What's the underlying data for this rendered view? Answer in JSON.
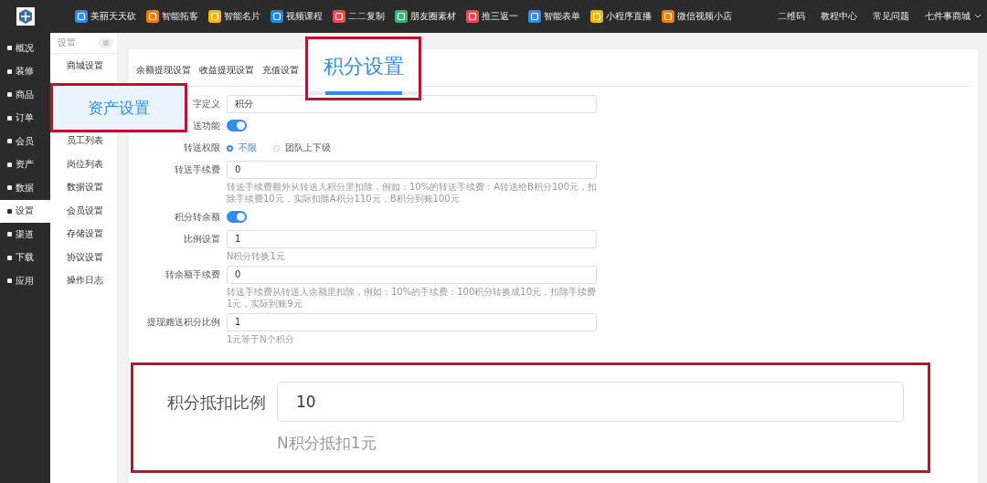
{
  "topbar": {
    "apps": [
      {
        "label": "美丽天天砍",
        "color": "#2f8cf0"
      },
      {
        "label": "智能拓客",
        "color": "#f57c00"
      },
      {
        "label": "智能名片",
        "color": "#f5b800"
      },
      {
        "label": "视频课程",
        "color": "#1e88e5"
      },
      {
        "label": "二二复制",
        "color": "#f04848"
      },
      {
        "label": "朋友圈素材",
        "color": "#3bb273"
      },
      {
        "label": "推三返一",
        "color": "#f04848"
      },
      {
        "label": "智能表单",
        "color": "#2f8cf0"
      },
      {
        "label": "小程序直播",
        "color": "#f5b800"
      },
      {
        "label": "微信视频小店",
        "color": "#f57c00"
      }
    ],
    "links": [
      "二维码",
      "教程中心",
      "常见问题"
    ],
    "account": "七件事商城"
  },
  "sidebar": {
    "items": [
      {
        "label": "概况",
        "selected": false
      },
      {
        "label": "装修",
        "selected": false
      },
      {
        "label": "商品",
        "selected": false
      },
      {
        "label": "订单",
        "selected": false
      },
      {
        "label": "会员",
        "selected": false
      },
      {
        "label": "资产",
        "selected": false
      },
      {
        "label": "数据",
        "selected": false
      },
      {
        "label": "设置",
        "selected": true
      },
      {
        "label": "渠道",
        "selected": false
      },
      {
        "label": "下载",
        "selected": false
      },
      {
        "label": "应用",
        "selected": false
      }
    ]
  },
  "subnav": {
    "title": "设置",
    "items": [
      "商城设置",
      "员工列表",
      "岗位列表",
      "数据设置",
      "会员设置",
      "存储设置",
      "协议设置",
      "操作日志"
    ]
  },
  "tabs": [
    {
      "label": "余额提现设置",
      "selected": false
    },
    {
      "label": "收益提现设置",
      "selected": false
    },
    {
      "label": "充值设置",
      "selected": false
    }
  ],
  "form": [
    {
      "kind": "input",
      "label": "字定义",
      "value": "积分"
    },
    {
      "kind": "switch",
      "label": "送功能",
      "on": true
    },
    {
      "kind": "radio",
      "label": "转送权限",
      "options": [
        {
          "label": "不限",
          "selected": true
        },
        {
          "label": "团队上下级",
          "selected": false
        }
      ]
    },
    {
      "kind": "input",
      "label": "转送手续费",
      "value": "0",
      "hint": "转送手续费额外从转送人积分里扣除，例如：10%的转送手续费：A转送给B积分100元，扣除手续费10元，实际扣除A积分110元，B积分到账100元"
    },
    {
      "kind": "switch",
      "label": "积分转余额",
      "on": true
    },
    {
      "kind": "input",
      "label": "比例设置",
      "value": "1",
      "hint": "N积分转换1元"
    },
    {
      "kind": "input",
      "label": "转余额手续费",
      "value": "0",
      "hint": "转送手续费从转送人余额里扣除，例如：10%的手续费：100积分转换成10元，扣除手续费1元，实际到账9元"
    },
    {
      "kind": "input",
      "label": "提现赠送积分比例",
      "value": "1",
      "hint": "1元等于N个积分"
    }
  ],
  "callouts": [
    {
      "kind": "nav",
      "text": "资产设置"
    },
    {
      "kind": "tab",
      "text": "积分设置"
    },
    {
      "kind": "field",
      "label": "积分抵扣比例",
      "value": "10",
      "hint": "N积分抵扣1元"
    }
  ]
}
